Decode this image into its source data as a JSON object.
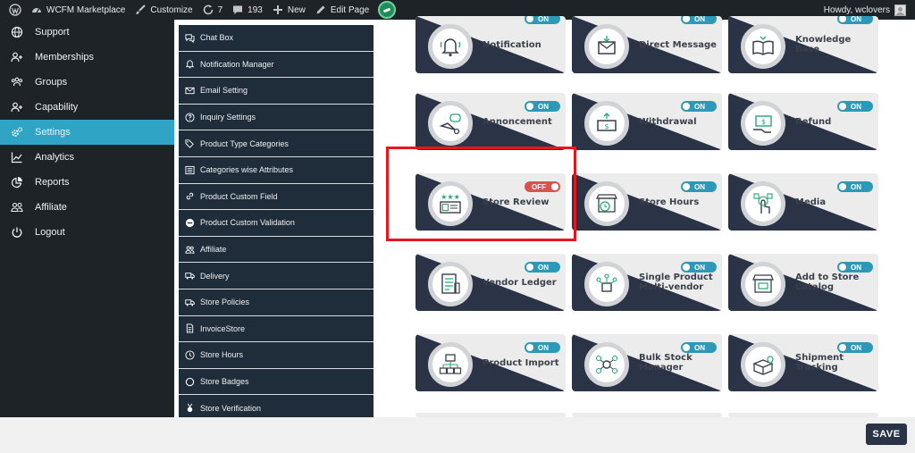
{
  "adminbar": {
    "site_name": "WCFM Marketplace",
    "customize": "Customize",
    "updates_count": "7",
    "comments_count": "193",
    "new_label": "New",
    "edit_page": "Edit Page",
    "howdy": "Howdy, wclovers"
  },
  "leftmenu": {
    "items": [
      {
        "label": "Support",
        "icon": "globe-icon"
      },
      {
        "label": "Memberships",
        "icon": "user-plus-icon"
      },
      {
        "label": "Groups",
        "icon": "group-icon"
      },
      {
        "label": "Capability",
        "icon": "user-plus-icon"
      },
      {
        "label": "Settings",
        "icon": "gears-icon",
        "active": true
      },
      {
        "label": "Analytics",
        "icon": "chart-icon"
      },
      {
        "label": "Reports",
        "icon": "pie-icon"
      },
      {
        "label": "Affiliate",
        "icon": "users-icon"
      },
      {
        "label": "Logout",
        "icon": "power-icon"
      }
    ]
  },
  "settings_nav": {
    "items": [
      {
        "label": "Chat Box"
      },
      {
        "label": "Notification Manager"
      },
      {
        "label": "Email Setting"
      },
      {
        "label": "Inquiry Settings"
      },
      {
        "label": "Product Type Categories"
      },
      {
        "label": "Categories wise Attributes"
      },
      {
        "label": "Product Custom Field"
      },
      {
        "label": "Product Custom Validation"
      },
      {
        "label": "Affiliate"
      },
      {
        "label": "Delivery"
      },
      {
        "label": "Store Policies"
      },
      {
        "label": "InvoiceStore"
      },
      {
        "label": "Store Hours"
      },
      {
        "label": "Store Badges"
      },
      {
        "label": "Store Verification"
      }
    ]
  },
  "modules": [
    {
      "label": "Notification",
      "status": "ON"
    },
    {
      "label": "Direct Message",
      "status": "ON"
    },
    {
      "label": "Knowledge Base",
      "status": "ON"
    },
    {
      "label": "Annoncement",
      "status": "ON"
    },
    {
      "label": "Withdrawal",
      "status": "ON"
    },
    {
      "label": "Refund",
      "status": "ON"
    },
    {
      "label": "Store Review",
      "status": "OFF"
    },
    {
      "label": "Store Hours",
      "status": "ON"
    },
    {
      "label": "Media",
      "status": "ON"
    },
    {
      "label": "Vendor Ledger",
      "status": "ON"
    },
    {
      "label": "Single Product Multi-vendor",
      "status": "ON"
    },
    {
      "label": "Add to Store Catalog",
      "status": "ON"
    },
    {
      "label": "Product Import",
      "status": "ON"
    },
    {
      "label": "Bulk Stock Manager",
      "status": "ON"
    },
    {
      "label": "Shipment Tracking",
      "status": "ON"
    }
  ],
  "save_label": "SAVE",
  "colors": {
    "accent": "#2fa4c4",
    "toggle_on": "#2d99b8",
    "toggle_off": "#d9534f",
    "card_dark": "#2b3346",
    "highlight": "#e8161c"
  }
}
